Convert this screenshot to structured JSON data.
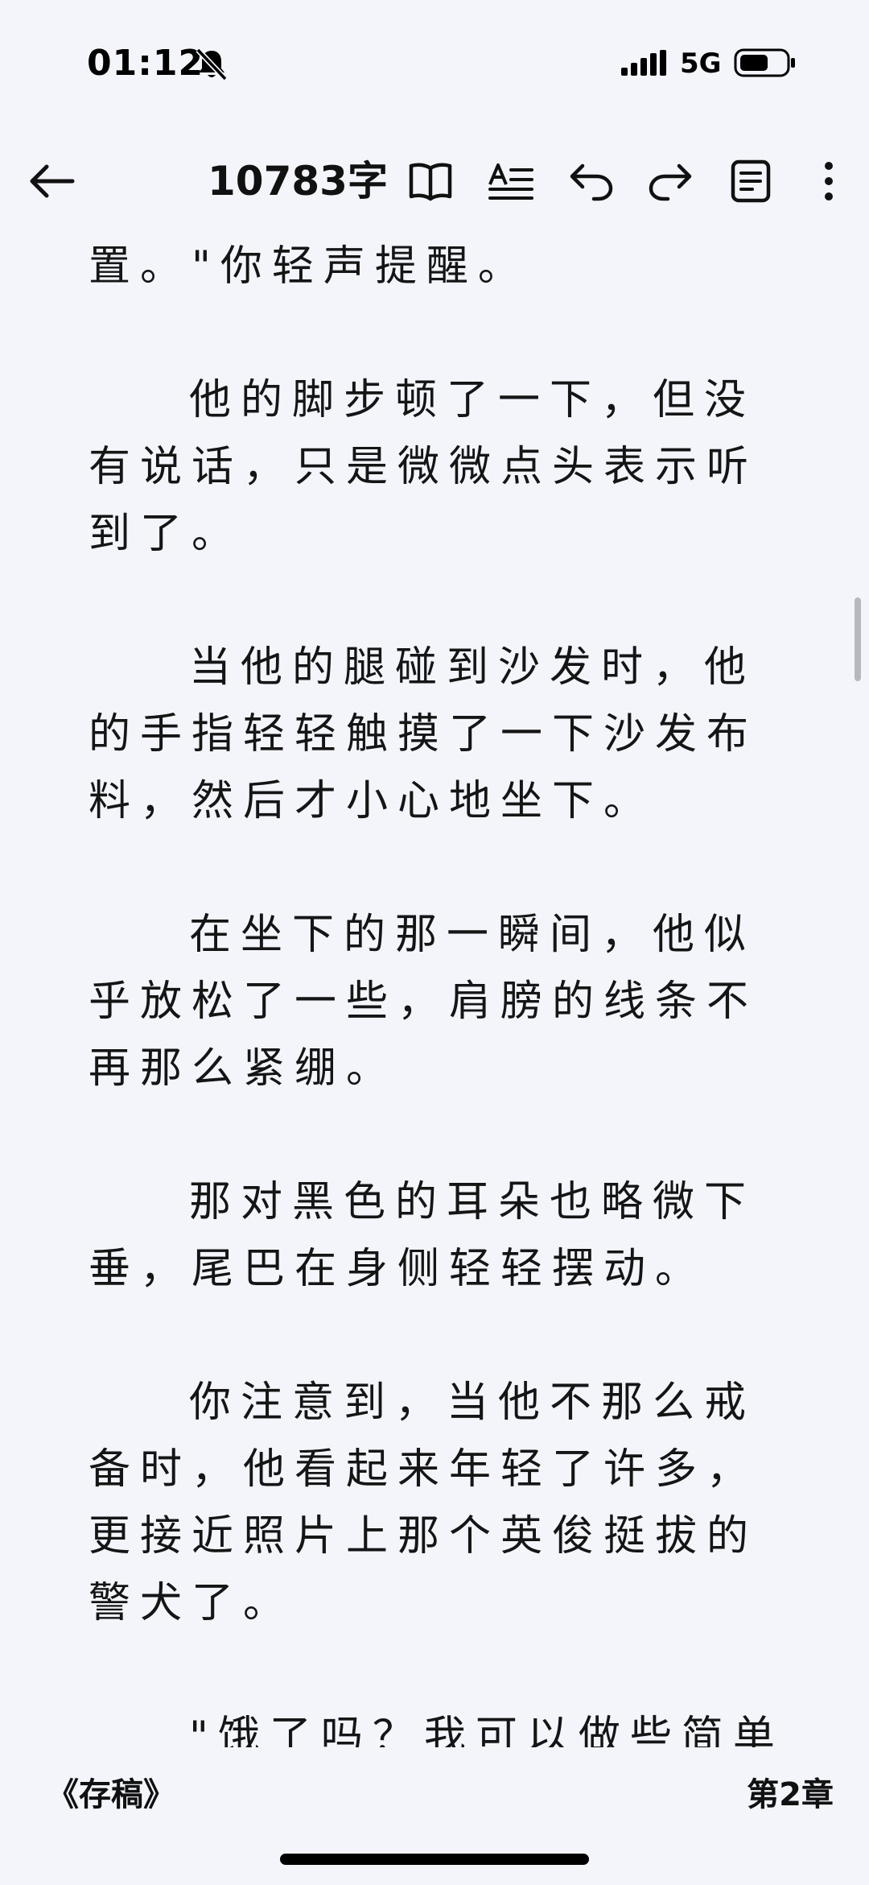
{
  "status_bar": {
    "time": "01:12",
    "network": "5G",
    "icons": [
      "bell-muted-icon",
      "signal-icon",
      "battery-icon"
    ]
  },
  "toolbar": {
    "word_count": "10783字",
    "icons": [
      "back-arrow-icon",
      "book-icon",
      "text-format-icon",
      "undo-icon",
      "redo-icon",
      "notes-icon",
      "more-vertical-icon"
    ]
  },
  "content": {
    "paragraphs": [
      "置。\"你轻声提醒。",
      "他的脚步顿了一下，但没有说话，只是微微点头表示听到了。",
      "当他的腿碰到沙发时，他的手指轻轻触摸了一下沙发布料，然后才小心地坐下。",
      "在坐下的那一瞬间，他似乎放松了一些，肩膀的线条不再那么紧绷。",
      "那对黑色的耳朵也略微下垂，尾巴在身侧轻轻摆动。",
      "你注意到，当他不那么戒备时，他看起来年轻了许多，更接近照片上那个英俊挺拔的警犬了。",
      "\"饿了吗？我可以做些简单"
    ]
  },
  "footer": {
    "book_title": "《存稿》",
    "chapter": "第2章"
  },
  "colors": {
    "background": "#f3f5fa",
    "text": "#151515",
    "scroll_thumb": "#b6b8be"
  }
}
